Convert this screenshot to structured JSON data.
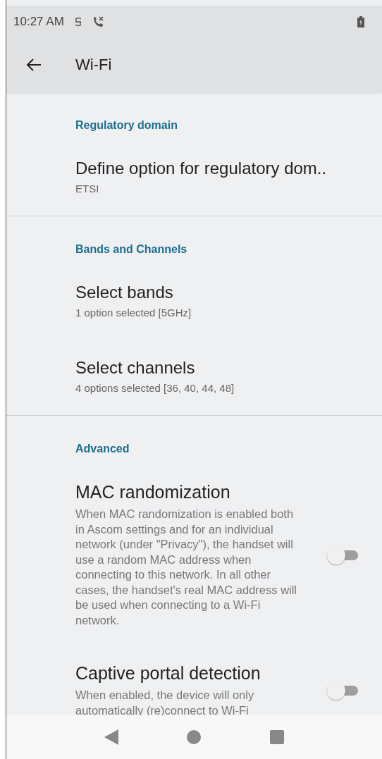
{
  "status_bar": {
    "time": "10:27 AM"
  },
  "app_bar": {
    "title": "Wi-Fi"
  },
  "sections": [
    {
      "header": "Regulatory domain",
      "items": [
        {
          "kind": "pref",
          "title": "Define option for regulatory dom..",
          "summary": "ETSI"
        }
      ]
    },
    {
      "header": "Bands and Channels",
      "items": [
        {
          "kind": "pref",
          "title": "Select bands",
          "summary": "1 option selected [5GHz]"
        },
        {
          "kind": "pref",
          "title": "Select channels",
          "summary": "4 options selected [36, 40, 44, 48]"
        }
      ]
    },
    {
      "header": "Advanced",
      "items": [
        {
          "kind": "switch",
          "title": "MAC randomization",
          "summary": "When MAC randomization is enabled both in Ascom settings and for an individual network (under \"Privacy\"), the handset will use a random MAC address when connecting to this network. In all other cases, the handset's real MAC address will be used when connecting to a Wi-Fi network.",
          "on": false
        },
        {
          "kind": "switch",
          "title": "Captive portal detection",
          "summary": "When enabled, the device will only automatically (re)connect to Wi-Fi",
          "on": false
        }
      ]
    }
  ]
}
